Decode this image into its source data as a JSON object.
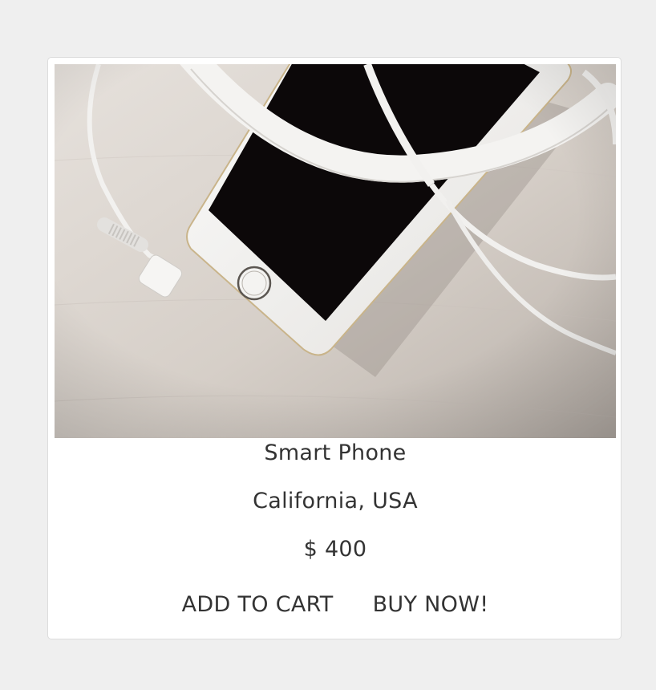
{
  "product": {
    "image_alt": "Smart Phone",
    "title": "Smart Phone",
    "location": "California, USA",
    "price": "$ 400"
  },
  "actions": {
    "add_to_cart_label": "ADD TO CART",
    "buy_now_label": "BUY NOW!"
  },
  "colors": {
    "page_background": "#efefef",
    "card_background": "#ffffff",
    "text": "#333333"
  }
}
